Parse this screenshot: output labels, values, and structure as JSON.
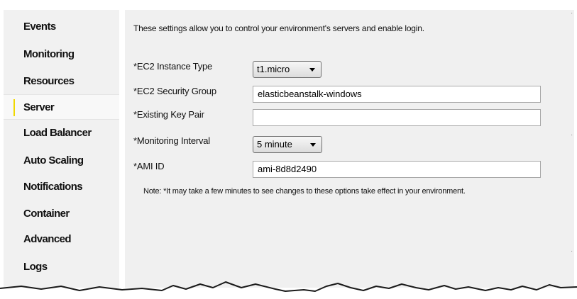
{
  "sidebar": {
    "items": [
      {
        "label": "Events",
        "active": false
      },
      {
        "label": "Monitoring",
        "active": false
      },
      {
        "label": "Resources",
        "active": false
      },
      {
        "label": "Server",
        "active": true
      },
      {
        "label": "Load Balancer",
        "active": false
      },
      {
        "label": "Auto Scaling",
        "active": false
      },
      {
        "label": "Notifications",
        "active": false
      },
      {
        "label": "Container",
        "active": false
      },
      {
        "label": "Advanced",
        "active": false
      },
      {
        "label": "Logs",
        "active": false
      }
    ],
    "active_marker_color": "#f0d800"
  },
  "main": {
    "intro": "These settings allow you to control your environment's servers and enable login.",
    "fields": {
      "instance_type": {
        "label": "*EC2 Instance Type",
        "value": "t1.micro"
      },
      "security_group": {
        "label": "*EC2 Security Group",
        "value": "elasticbeanstalk-windows"
      },
      "key_pair": {
        "label": "*Existing Key Pair",
        "value": ""
      },
      "monitoring_interval": {
        "label": "*Monitoring Interval",
        "value": "5 minute"
      },
      "ami_id": {
        "label": "*AMI ID",
        "value": "ami-8d8d2490"
      }
    },
    "note": "Note: *It may take a few minutes to see changes to these options take effect in your environment."
  }
}
